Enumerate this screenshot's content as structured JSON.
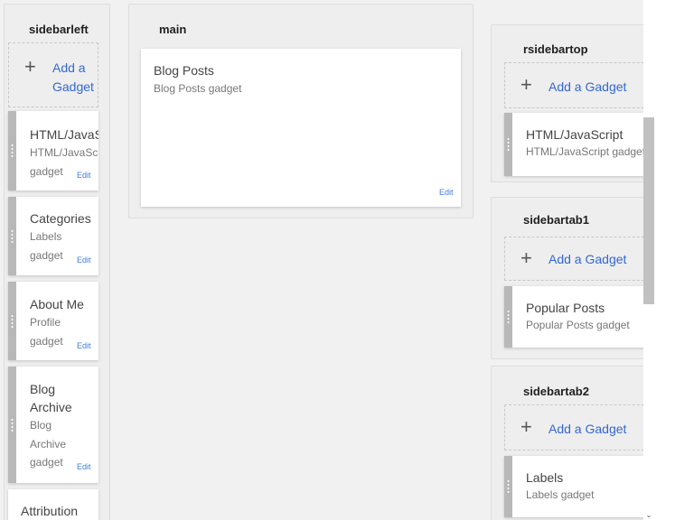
{
  "sidebarleft": {
    "title": "sidebarleft",
    "add_gadget_line1": "Add a",
    "add_gadget_line2": "Gadget",
    "gadgets": [
      {
        "title_line1": "HTML/JavaS",
        "desc_line1": "HTML/JavaSc",
        "desc_line2": "gadget",
        "edit": "Edit"
      },
      {
        "title_line1": "Categories",
        "desc_line1": "Labels",
        "desc_line2": "gadget",
        "edit": "Edit"
      },
      {
        "title_line1": "About Me",
        "desc_line1": "Profile",
        "desc_line2": "gadget",
        "edit": "Edit"
      },
      {
        "title_line1": "Blog",
        "title_line2": "Archive",
        "desc_line1": "Blog",
        "desc_line2": "Archive",
        "desc_line3": "gadget",
        "edit": "Edit"
      },
      {
        "title_line1": "Attribution"
      }
    ]
  },
  "main": {
    "title": "main",
    "gadget": {
      "title": "Blog Posts",
      "desc": "Blog Posts gadget",
      "edit": "Edit"
    }
  },
  "rsidebartop": {
    "title": "rsidebartop",
    "add_gadget": "Add a Gadget",
    "gadget": {
      "title": "HTML/JavaScript",
      "desc": "HTML/JavaScript gadget"
    }
  },
  "sidebartab1": {
    "title": "sidebartab1",
    "add_gadget": "Add a Gadget",
    "gadget": {
      "title": "Popular Posts",
      "desc": "Popular Posts gadget"
    }
  },
  "sidebartab2": {
    "title": "sidebartab2",
    "add_gadget": "Add a Gadget",
    "gadget": {
      "title": "Labels",
      "desc": "Labels gadget"
    }
  },
  "icons": {
    "plus": "+",
    "scroll_down": "⌄"
  },
  "colors": {
    "link": "#3367d6",
    "edit": "#3d7fe0",
    "handle": "#b8b8b8",
    "canvas": "#f1f1f1"
  }
}
